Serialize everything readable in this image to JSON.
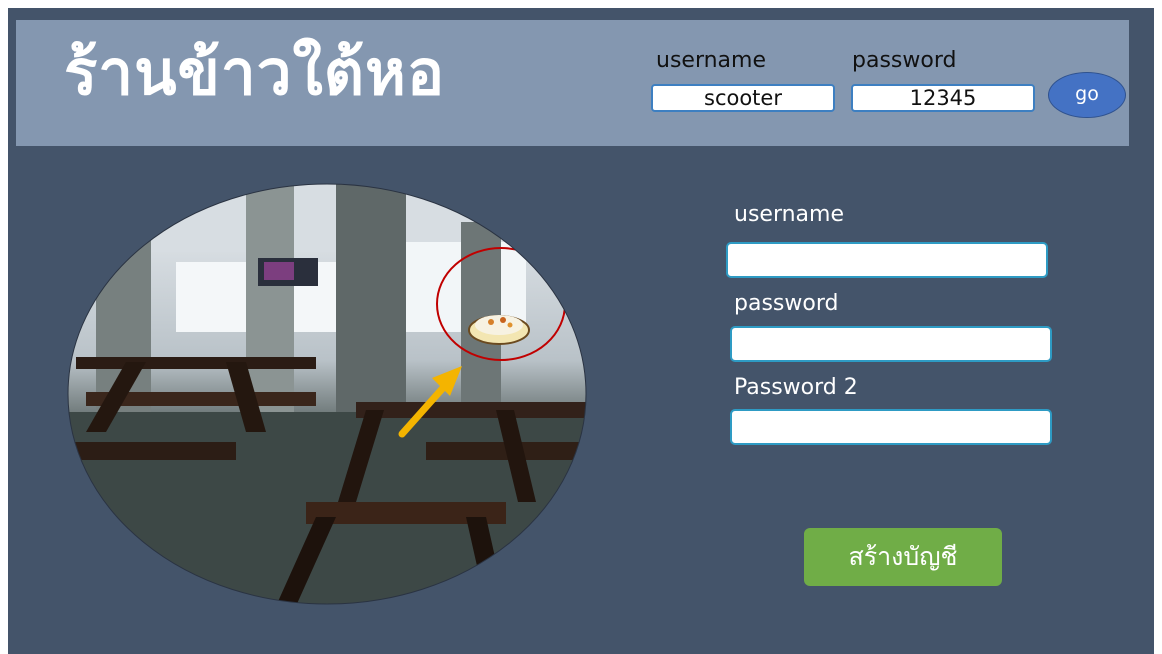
{
  "header": {
    "title": "ร้านข้าวใต้หอ",
    "login": {
      "username_label": "username",
      "password_label": "password",
      "username_value": "scooter",
      "password_value": "12345",
      "go_label": "go"
    }
  },
  "register": {
    "username_label": "username",
    "password_label": "password",
    "password2_label": "Password 2",
    "create_label": "สร้างบัญชี"
  },
  "colors": {
    "background": "#44546a",
    "header": "#8497b0",
    "go_button": "#4472c4",
    "create_button": "#70ad47",
    "highlight_circle": "#c00000",
    "arrow": "#f4b400"
  },
  "icons": {
    "photo": "canteen-photo",
    "food": "rice-plate-icon",
    "arrow": "arrow-icon"
  }
}
